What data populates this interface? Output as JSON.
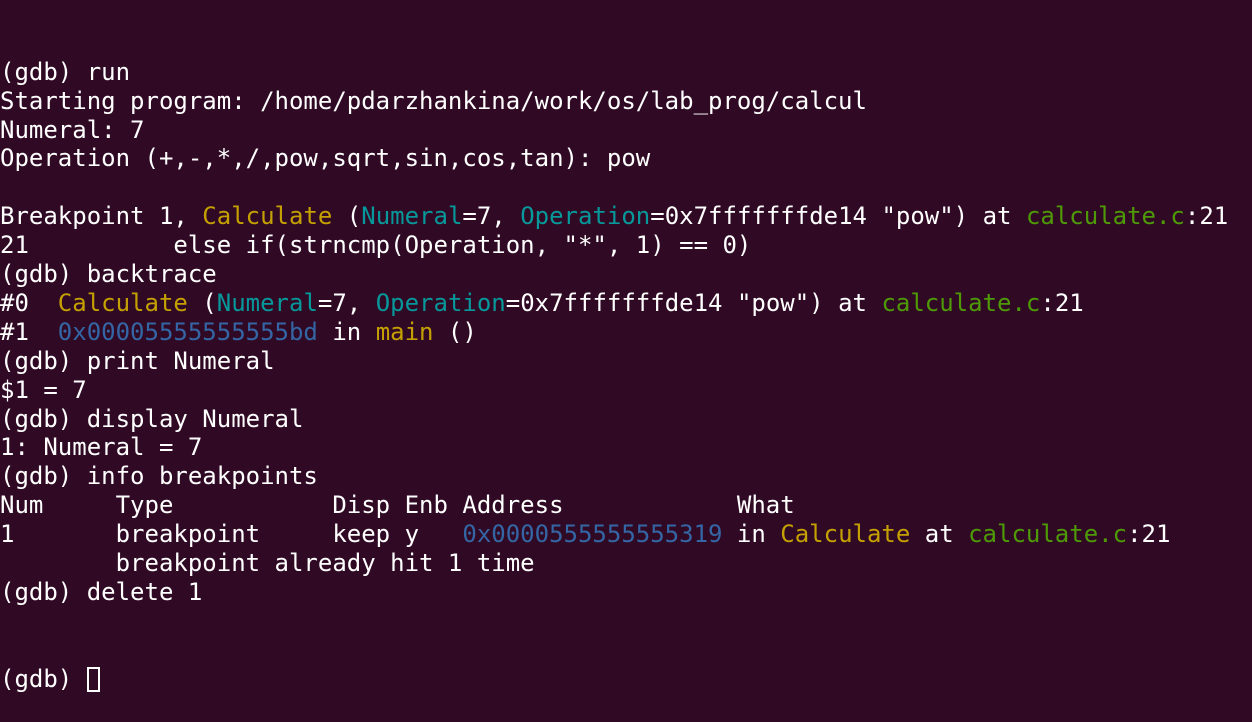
{
  "colors": {
    "background": "#300a24",
    "text": "#ffffff",
    "function": "#c4a000",
    "parameter": "#06989a",
    "file": "#4e9a06",
    "address": "#3465a4"
  },
  "terminal": {
    "prompt": "(gdb)",
    "lines": [
      [
        {
          "t": "(gdb) run"
        }
      ],
      [
        {
          "t": "Starting program: /home/pdarzhankina/work/os/lab_prog/calcul"
        }
      ],
      [
        {
          "t": "Numeral: 7"
        }
      ],
      [
        {
          "t": "Operation (+,-,*,/,pow,sqrt,sin,cos,tan): pow"
        }
      ],
      [
        {
          "t": ""
        }
      ],
      [
        {
          "t": "Breakpoint 1, "
        },
        {
          "t": "Calculate",
          "c": "fn"
        },
        {
          "t": " ("
        },
        {
          "t": "Numeral",
          "c": "param"
        },
        {
          "t": "=7, "
        },
        {
          "t": "Operation",
          "c": "param"
        },
        {
          "t": "=0x7fffffffde14 \"pow\") at "
        },
        {
          "t": "calculate.c",
          "c": "file"
        },
        {
          "t": ":21"
        }
      ],
      [
        {
          "t": "21          else if(strncmp(Operation, \"*\", 1) == 0)"
        }
      ],
      [
        {
          "t": "(gdb) backtrace"
        }
      ],
      [
        {
          "t": "#0  "
        },
        {
          "t": "Calculate",
          "c": "fn"
        },
        {
          "t": " ("
        },
        {
          "t": "Numeral",
          "c": "param"
        },
        {
          "t": "=7, "
        },
        {
          "t": "Operation",
          "c": "param"
        },
        {
          "t": "=0x7fffffffde14 \"pow\") at "
        },
        {
          "t": "calculate.c",
          "c": "file"
        },
        {
          "t": ":21"
        }
      ],
      [
        {
          "t": "#1  "
        },
        {
          "t": "0x00005555555555bd",
          "c": "addr"
        },
        {
          "t": " in "
        },
        {
          "t": "main",
          "c": "fn"
        },
        {
          "t": " ()"
        }
      ],
      [
        {
          "t": "(gdb) print Numeral"
        }
      ],
      [
        {
          "t": "$1 = 7"
        }
      ],
      [
        {
          "t": "(gdb) display Numeral"
        }
      ],
      [
        {
          "t": "1: Numeral = 7"
        }
      ],
      [
        {
          "t": "(gdb) info breakpoints"
        }
      ],
      [
        {
          "t": "Num     Type           Disp Enb Address            What"
        }
      ],
      [
        {
          "t": "1       breakpoint     keep y   "
        },
        {
          "t": "0x0000555555555319",
          "c": "addr"
        },
        {
          "t": " in "
        },
        {
          "t": "Calculate",
          "c": "fn"
        },
        {
          "t": " at "
        },
        {
          "t": "calculate.c",
          "c": "file"
        },
        {
          "t": ":21"
        }
      ],
      [
        {
          "t": "        breakpoint already hit 1 time"
        }
      ],
      [
        {
          "t": "(gdb) delete 1"
        }
      ]
    ]
  }
}
